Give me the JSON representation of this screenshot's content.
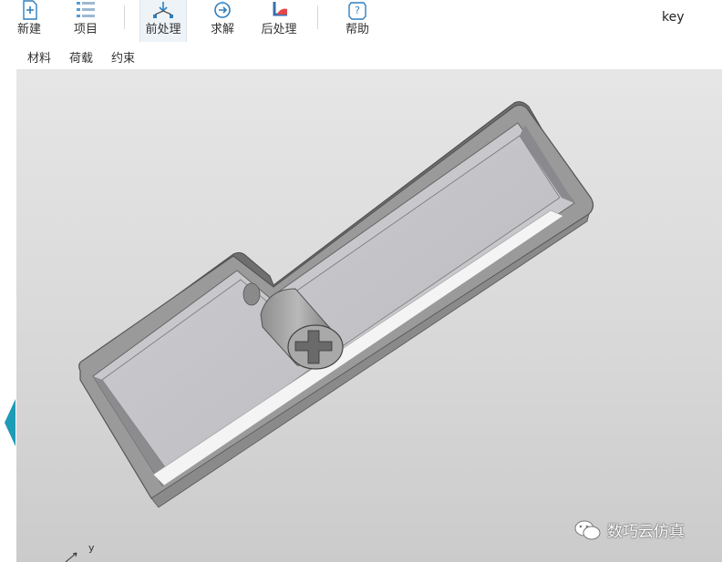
{
  "toolbar": {
    "items": [
      {
        "label": "新建",
        "icon": "new-file-icon"
      },
      {
        "label": "项目",
        "icon": "project-list-icon"
      },
      {
        "label": "前处理",
        "icon": "preprocess-icon"
      },
      {
        "label": "求解",
        "icon": "solve-icon"
      },
      {
        "label": "后处理",
        "icon": "postprocess-icon"
      },
      {
        "label": "帮助",
        "icon": "help-icon"
      }
    ],
    "active": "前处理",
    "user": "key"
  },
  "submenu": {
    "items": [
      "材料",
      "荷载",
      "约束"
    ]
  },
  "viewport": {
    "axis_label": "y",
    "watermark": "数巧云仿真"
  },
  "colors": {
    "accent": "#1f9bb6",
    "icon_blue": "#2f7fbf"
  }
}
